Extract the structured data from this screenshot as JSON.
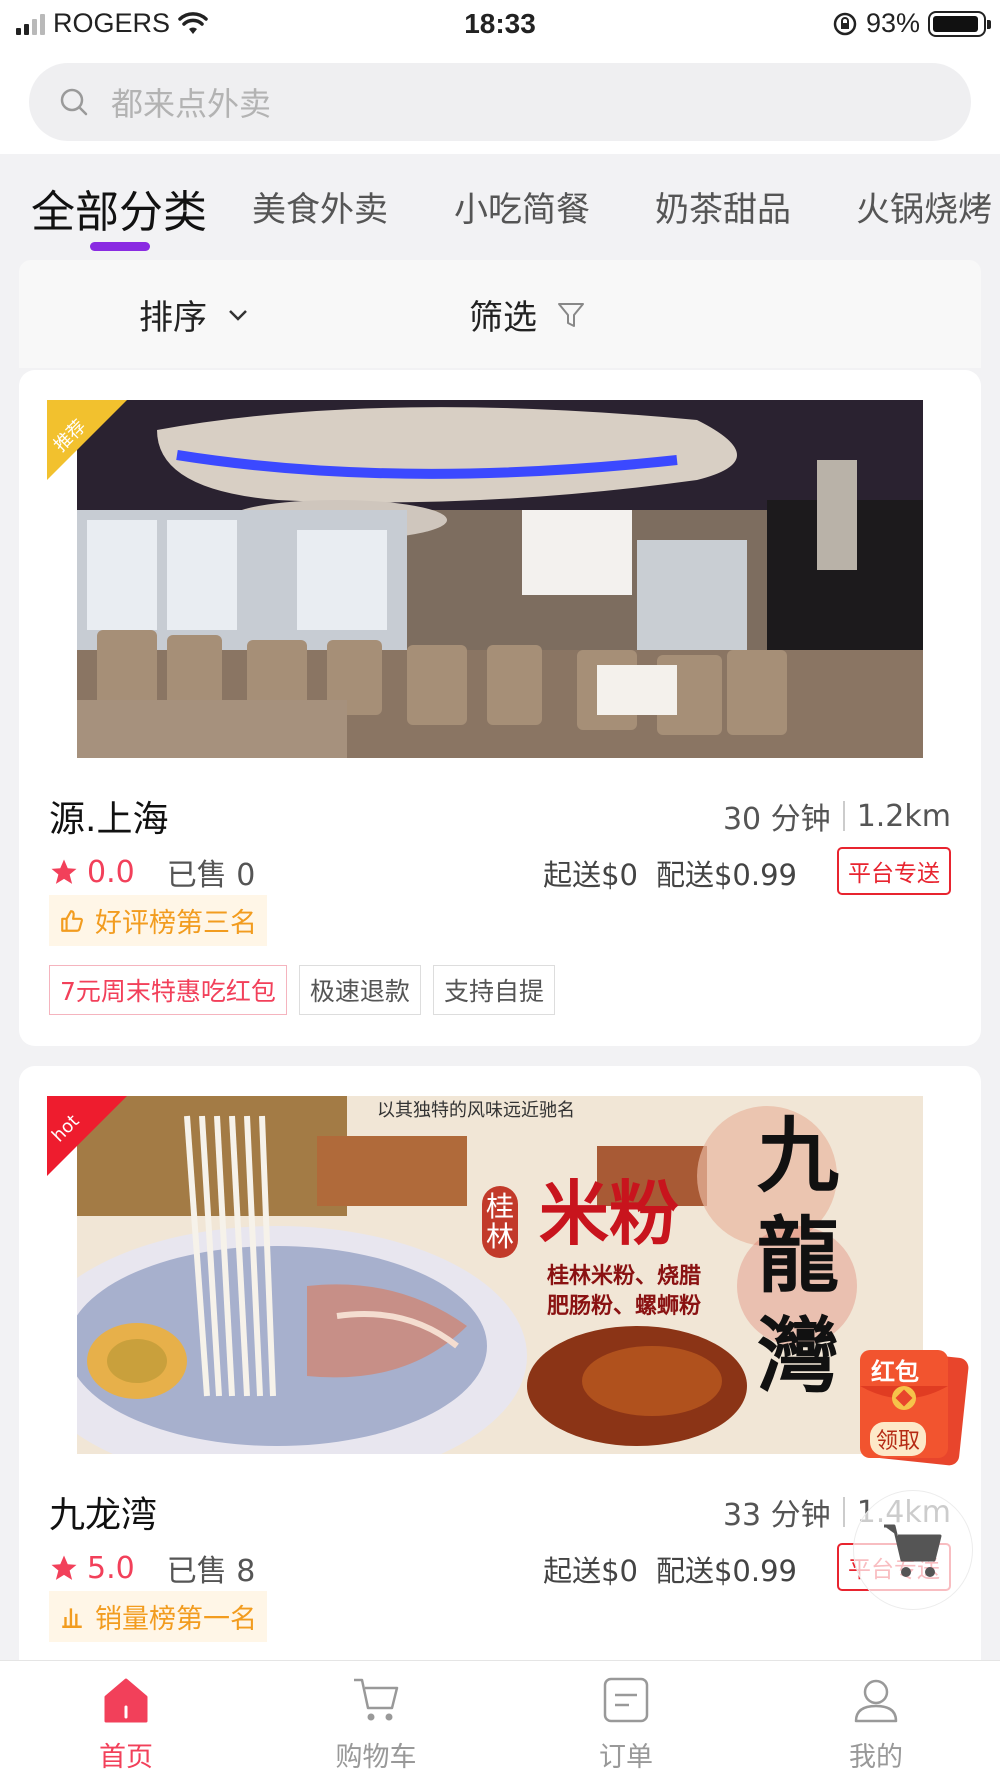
{
  "status_bar": {
    "carrier": "ROGERS",
    "time": "18:33",
    "battery": "93%",
    "battery_level": 0.93
  },
  "search": {
    "placeholder": "都来点外卖"
  },
  "categories": [
    "全部分类",
    "美食外卖",
    "小吃简餐",
    "奶茶甜品",
    "火锅烧烤"
  ],
  "filter_bar": {
    "sort_label": "排序",
    "filter_label": "筛选"
  },
  "shops": [
    {
      "corner_badge": "推荐",
      "corner_color": "#f2c12e",
      "name": "源.上海",
      "time": "30 分钟",
      "distance": "1.2km",
      "rating": "0.0",
      "sold": "已售 0",
      "min_order": "起送$0",
      "delivery_fee": "配送$0.99",
      "platform_tag": "平台专送",
      "rank_badge": "好评榜第三名",
      "tags": [
        "7元周末特惠吃红包",
        "极速退款",
        "支持自提"
      ]
    },
    {
      "corner_badge": "hot",
      "corner_color": "#ee1c2e",
      "name": "九龙湾",
      "time": "33 分钟",
      "distance": "1.4km",
      "rating": "5.0",
      "sold": "已售 8",
      "min_order": "起送$0",
      "delivery_fee": "配送$0.99",
      "platform_tag": "平台专送",
      "rank_badge": "销量榜第一名",
      "banner_text": {
        "city": "桂林",
        "dish": "米粉",
        "menu_line1": "桂林米粉、烧腊",
        "menu_line2": "肥肠粉、螺蛳粉",
        "slogan": "以其独特的风味远近驰名",
        "brand": "九龍灣"
      }
    }
  ],
  "red_packet": {
    "line1": "红包",
    "line2": "领取"
  },
  "bottom_nav": [
    {
      "label": "首页",
      "icon": "home-icon",
      "active": true
    },
    {
      "label": "购物车",
      "icon": "cart-icon",
      "active": false
    },
    {
      "label": "订单",
      "icon": "order-icon",
      "active": false
    },
    {
      "label": "我的",
      "icon": "profile-icon",
      "active": false
    }
  ],
  "colors": {
    "accent": "#f2405a",
    "tab_indicator": "#8a2be2",
    "rank_text": "#f29c1f",
    "platform_red": "#e8242f"
  }
}
